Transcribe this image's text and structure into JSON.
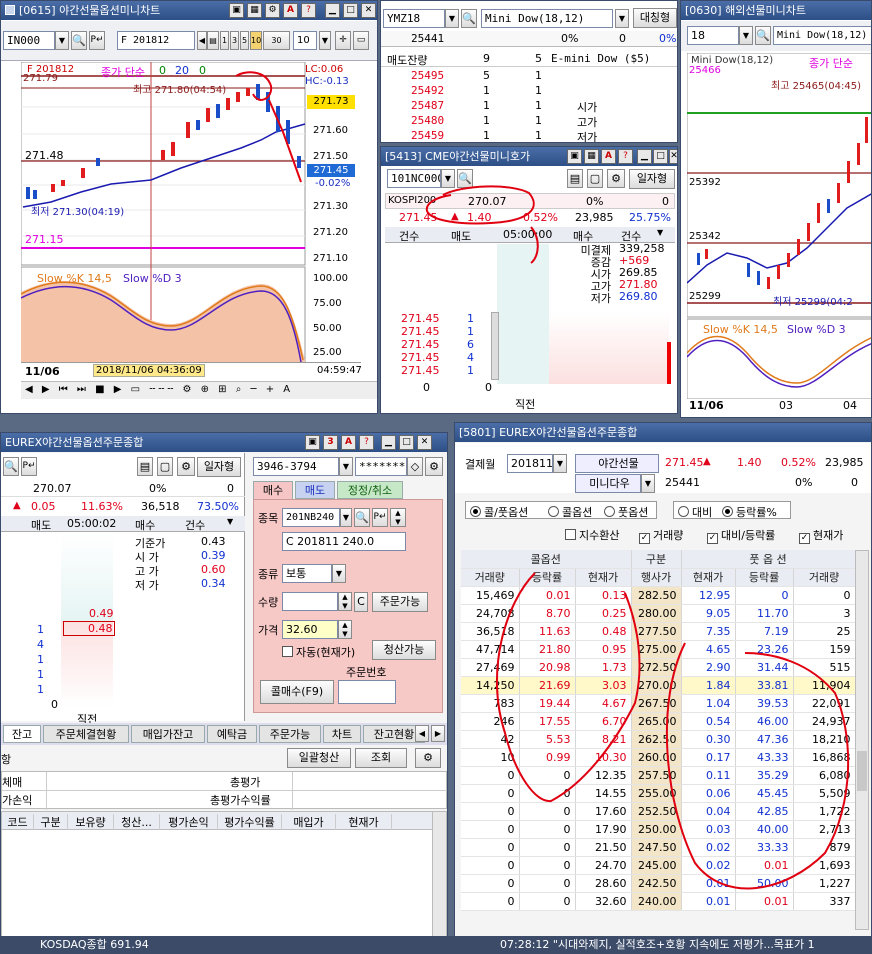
{
  "chart_0615": {
    "title": "[0615] 야간선물옵션미니차트",
    "code": "IN000",
    "series_label": "F 201812",
    "ctl_numbers": [
      "1",
      "3",
      "5",
      "10",
      "30",
      "10"
    ],
    "price_label": "F 201812",
    "indicator_label": "종가 단순",
    "ind_values": [
      "0",
      "20",
      "0"
    ],
    "lc": "LC:0.06",
    "hc": "HC:-0.13",
    "high_annot": "최고 271.80(04:54)",
    "low_annot": "최저 271.30(04:19)",
    "last_left": "271.48",
    "current_badge": "271.73",
    "current_badge2": "271.45",
    "pct_badge": "-0.02%",
    "line_magenta": "271.15",
    "top_price": "271.79",
    "y_ticks": [
      "271.70",
      "271.60",
      "271.50",
      "271.40",
      "271.30",
      "271.20",
      "271.10"
    ],
    "osc_label1": "Slow %K 14,5",
    "osc_label2": "Slow %D 3",
    "osc_ticks": [
      "100.00",
      "75.00",
      "50.00",
      "25.00"
    ],
    "date_left": "11/06",
    "cursor_time": "2018/11/06 04:36:09",
    "clock": "04:59:47",
    "toolbar_icons": [
      "◀",
      "▶",
      "⏮",
      "⏭",
      "■",
      "▶",
      "▭"
    ]
  },
  "ymz": {
    "code": "YMZ18",
    "name": "Mini Dow(18,12)",
    "button": "대칭형",
    "price": "25441",
    "pct": "0%",
    "val1": "0",
    "val2": "0%",
    "hdr_label": "매도잔량",
    "hdr_a": "9",
    "hdr_b": "5",
    "hdr_name": "E-mini Dow ($5)",
    "rows": [
      {
        "price": "25495",
        "q1": "5",
        "q2": "1",
        "lab": ""
      },
      {
        "price": "25492",
        "q1": "1",
        "q2": "1",
        "lab": ""
      },
      {
        "price": "25487",
        "q1": "1",
        "q2": "1",
        "lab": "시가"
      },
      {
        "price": "25480",
        "q1": "1",
        "q2": "1",
        "lab": "고가"
      },
      {
        "price": "25459",
        "q1": "1",
        "q2": "1",
        "lab": "저가"
      }
    ]
  },
  "cme": {
    "title": "[5413] CME야간선물미니호가",
    "code": "101NC000",
    "button": "일자형",
    "kospi_label": "KOSPI200",
    "kospi_val": "270.07",
    "kospi_pct": "0%",
    "kospi_val2": "0",
    "price": "271.45",
    "change": "1.40",
    "pct": "0.52%",
    "volume": "23,985",
    "ratio": "25.75%",
    "h_count": "건수",
    "h_sell": "매도",
    "h_time": "05:00:00",
    "h_buy": "매수",
    "h_count2": "건수",
    "stats": [
      {
        "k": "미결제",
        "v": "339,258"
      },
      {
        "k": "증감",
        "v": "+569"
      },
      {
        "k": "시가",
        "v": "269.85"
      },
      {
        "k": "고가",
        "v": "271.80"
      },
      {
        "k": "저가",
        "v": "269.80"
      }
    ],
    "bid_rows": [
      {
        "p": "271.45",
        "q": "1"
      },
      {
        "p": "271.45",
        "q": "1"
      },
      {
        "p": "271.45",
        "q": "6"
      },
      {
        "p": "271.45",
        "q": "4"
      },
      {
        "p": "271.45",
        "q": "1"
      }
    ],
    "sum_left": "0",
    "sum_right": "0",
    "footer": "직전"
  },
  "chart_0630": {
    "title": "[0630] 해외선물미니차트",
    "code": "18",
    "name": "Mini Dow(18,12)",
    "indicator": "종가 단순",
    "top_price": "25466",
    "high_annot": "최고 25465(04:45)",
    "low_annot": "최저 25299(04:2",
    "p1": "25392",
    "p2": "25342",
    "p3": "25299",
    "osc1": "Slow %K 14,5",
    "osc2": "Slow %D 3",
    "date": "11/06",
    "d2": "03",
    "d3": "04"
  },
  "eurex_left": {
    "title": "EUREX야간선물옵션주문종합",
    "button": "일자형",
    "price": "270.07",
    "pct": "0%",
    "val": "0",
    "chg": "0.05",
    "pct2": "11.63%",
    "vol": "36,518",
    "ratio": "73.50%",
    "h_sell": "매도",
    "h_time": "05:00:02",
    "h_buy": "매수",
    "h_cnt": "건수",
    "stats": [
      {
        "k": "기준가",
        "v": "0.43"
      },
      {
        "k": "시 가",
        "v": "0.39"
      },
      {
        "k": "고 가",
        "v": "0.60"
      },
      {
        "k": "저 가",
        "v": "0.34"
      }
    ],
    "ask_price": "0.49",
    "bid_price": "0.48",
    "bid_qtys": [
      "1",
      "4",
      "1",
      "1",
      "1"
    ],
    "sum": "0",
    "footer": "직전",
    "account": "3946-3794",
    "password": "********",
    "tab_buy": "매수",
    "tab_sell": "매도",
    "tab_mod": "정정/취소",
    "f_item": "종목",
    "item_code": "201NB240",
    "item_name": "C 201811 240.0",
    "f_type": "종류",
    "type_val": "보통",
    "f_qty": "수량",
    "qty_c": "C",
    "btn_orderable": "주문가능",
    "f_price": "가격",
    "price_val": "32.60",
    "auto_chk": "자동(현재가)",
    "btn_clear": "청산가능",
    "order_no_label": "주문번호",
    "btn_buy": "콜매수(F9)",
    "bottom_tabs": [
      "잔고",
      "주문체결현황",
      "매입가잔고",
      "예탁금",
      "주문가능",
      "차트",
      "잔고현황"
    ],
    "btn_settle_all": "일괄청산",
    "btn_query": "조회",
    "row_label_cut": "항",
    "lbl_buy": "체매",
    "lbl_total_eval": "총평가",
    "lbl_pnl": "가손익",
    "lbl_total_pnl": "총평가수익률",
    "cols": [
      "코드",
      "구분",
      "보유량",
      "청산...",
      "평가손익",
      "평가수익률",
      "매입가",
      "현재가"
    ]
  },
  "eurex_right": {
    "title": "[5801] EUREX야간선물옵션주문종합",
    "expiry_label": "결제월",
    "expiry": "201811",
    "night_label": "야간선물",
    "price": "271.45",
    "chg": "1.40",
    "pct": "0.52%",
    "vol": "23,985",
    "mini_label": "미니다우",
    "mini_price": "25441",
    "mini_pct": "0%",
    "mini_val": "0",
    "radios": [
      "콜/풋옵션",
      "콜옵션",
      "풋옵션"
    ],
    "radios2": [
      "대비",
      "등락률%"
    ],
    "checks": [
      "지수환산",
      "거래량",
      "대비/등락률",
      "현재가"
    ],
    "grp_call": "콜옵션",
    "grp_mid": "구분",
    "grp_put": "풋 옵 션",
    "cols": [
      "거래량",
      "등락률",
      "현재가",
      "행사가",
      "현재가",
      "등락률",
      "거래량"
    ],
    "rows": [
      [
        "15,469",
        "0.01",
        "0.13",
        "282.50",
        "12.95",
        "0",
        "0"
      ],
      [
        "24,708",
        "8.70",
        "0.25",
        "280.00",
        "9.05",
        "11.70",
        "3"
      ],
      [
        "36,518",
        "11.63",
        "0.48",
        "277.50",
        "7.35",
        "7.19",
        "25"
      ],
      [
        "47,714",
        "21.80",
        "0.95",
        "275.00",
        "4.65",
        "23.26",
        "159"
      ],
      [
        "27,469",
        "20.98",
        "1.73",
        "272.50",
        "2.90",
        "31.44",
        "515"
      ],
      [
        "14,250",
        "21.69",
        "3.03",
        "270.00",
        "1.84",
        "33.81",
        "11,904"
      ],
      [
        "783",
        "19.44",
        "4.67",
        "267.50",
        "1.04",
        "39.53",
        "22,091"
      ],
      [
        "246",
        "17.55",
        "6.70",
        "265.00",
        "0.54",
        "46.00",
        "24,937"
      ],
      [
        "42",
        "5.53",
        "8.21",
        "262.50",
        "0.30",
        "47.36",
        "18,210"
      ],
      [
        "10",
        "0.99",
        "10.30",
        "260.00",
        "0.17",
        "43.33",
        "16,868"
      ],
      [
        "0",
        "0",
        "12.35",
        "257.50",
        "0.11",
        "35.29",
        "6,080"
      ],
      [
        "0",
        "0",
        "14.55",
        "255.00",
        "0.06",
        "45.45",
        "5,509"
      ],
      [
        "0",
        "0",
        "17.60",
        "252.50",
        "0.04",
        "42.85",
        "1,722"
      ],
      [
        "0",
        "0",
        "17.90",
        "250.00",
        "0.03",
        "40.00",
        "2,713"
      ],
      [
        "0",
        "0",
        "21.50",
        "247.50",
        "0.02",
        "33.33",
        "879"
      ],
      [
        "0",
        "0",
        "24.70",
        "245.00",
        "0.02",
        "0.01",
        "1,693"
      ],
      [
        "0",
        "0",
        "28.60",
        "242.50",
        "0.01",
        "50.00",
        "1,227"
      ],
      [
        "0",
        "0",
        "32.60",
        "240.00",
        "0.01",
        "0.01",
        "337"
      ]
    ]
  },
  "statusbar": {
    "left": "KOSDAQ종합  691.94",
    "right": "07:28:12 \"시대와제지, 실적호조+호황 지속에도 저평가...목표가 1"
  }
}
